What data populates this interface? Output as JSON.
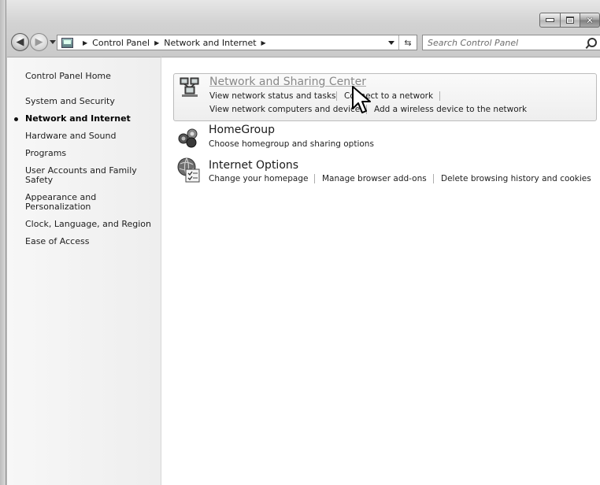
{
  "window": {
    "caption_buttons": [
      "minimize",
      "maximize",
      "close"
    ]
  },
  "address": {
    "crumbs": [
      "Control Panel",
      "Network and Internet"
    ],
    "search_placeholder": "Search Control Panel"
  },
  "sidebar": {
    "items": [
      {
        "label": "Control Panel Home",
        "active": false
      },
      {
        "label": "System and Security",
        "active": false
      },
      {
        "label": "Network and Internet",
        "active": true
      },
      {
        "label": "Hardware and Sound",
        "active": false
      },
      {
        "label": "Programs",
        "active": false
      },
      {
        "label": "User Accounts and Family Safety",
        "active": false
      },
      {
        "label": "Appearance and Personalization",
        "active": false
      },
      {
        "label": "Clock, Language, and Region",
        "active": false
      },
      {
        "label": "Ease of Access",
        "active": false
      }
    ]
  },
  "categories": [
    {
      "title": "Network and Sharing Center",
      "icon": "network-sharing-icon",
      "tasks": [
        "View network status and tasks",
        "Connect to a network",
        "View network computers and devices",
        "Add a wireless device to the network"
      ]
    },
    {
      "title": "HomeGroup",
      "icon": "homegroup-icon",
      "tasks": [
        "Choose homegroup and sharing options"
      ]
    },
    {
      "title": "Internet Options",
      "icon": "internet-options-icon",
      "tasks": [
        "Change your homepage",
        "Manage browser add-ons",
        "Delete browsing history and cookies"
      ]
    }
  ],
  "colors": {
    "hover_title": "#888888",
    "text": "#1e1e1e",
    "sidebar_bg": "#f2f2f2"
  }
}
